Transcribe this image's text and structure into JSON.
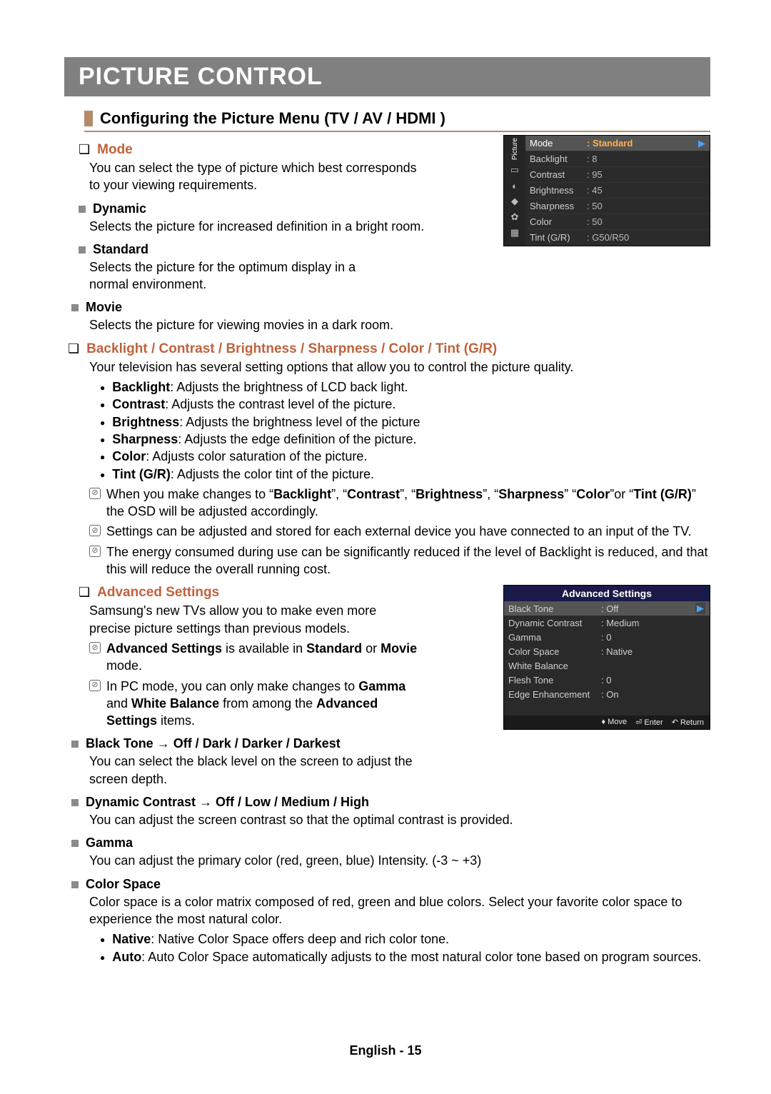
{
  "title": "PICTURE CONTROL",
  "subtitle": "Configuring the Picture Menu (TV / AV / HDMI )",
  "mode": {
    "heading": "Mode",
    "intro": "You can select the type of picture which best corresponds to your viewing requirements.",
    "dynamic_h": "Dynamic",
    "dynamic_t": "Selects the picture for increased definition in a bright room.",
    "standard_h": "Standard",
    "standard_t": "Selects the picture for the optimum display in a normal environment.",
    "movie_h": "Movie",
    "movie_t": "Selects the picture for viewing movies in a dark room."
  },
  "adj": {
    "heading": "Backlight / Contrast / Brightness / Sharpness / Color / Tint (G/R)",
    "intro": "Your television has several setting options that allow you to control the picture quality.",
    "b1_l": "Backlight",
    "b1_t": ": Adjusts the brightness of LCD back light.",
    "b2_l": "Contrast",
    "b2_t": ": Adjusts the contrast level of the picture.",
    "b3_l": "Brightness",
    "b3_t": ": Adjusts the brightness level of the picture",
    "b4_l": "Sharpness",
    "b4_t": ": Adjusts the edge definition of the picture.",
    "b5_l": "Color",
    "b5_t": ": Adjusts color saturation of the picture.",
    "b6_l": "Tint (G/R)",
    "b6_t": ": Adjusts the color tint of the picture.",
    "n1a": "When you make changes to “",
    "n1b": "Backlight",
    "n1c": "”, “",
    "n1d": "Contrast",
    "n1e": "”, “",
    "n1f": "Brightness",
    "n1g": "”, “",
    "n1h": "Sharpness",
    "n1i": "” “",
    "n1j": "Color",
    "n1k": "”or “",
    "n1l": "Tint (G/R)",
    "n1m": "” the OSD will be adjusted accordingly.",
    "n2": "Settings can be adjusted and stored for each external device you have connected to an input of the TV.",
    "n3": "The energy consumed during use can be significantly reduced if the level of Backlight is reduced, and that this will reduce the overall running cost."
  },
  "adv": {
    "heading": "Advanced Settings",
    "intro": "Samsung's new TVs allow you to make even more precise picture settings than previous models.",
    "n1_a": "Advanced Settings",
    "n1_b": " is available in ",
    "n1_c": "Standard",
    "n1_d": " or ",
    "n1_e": "Movie",
    "n1_f": " mode.",
    "n2_a": "In PC mode, you can only make changes to ",
    "n2_b": "Gamma",
    "n2_c": " and ",
    "n2_d": "White Balance",
    "n2_e": " from among the ",
    "n2_f": "Advanced Settings",
    "n2_g": " items.",
    "bt_h": "Black Tone → Off / Dark / Darker / Darkest",
    "bt_t": "You can select the black level on the screen to adjust the screen depth.",
    "dc_h": "Dynamic Contrast → Off / Low / Medium / High",
    "dc_t": "You can adjust the screen contrast so that the optimal contrast is provided.",
    "g_h": "Gamma",
    "g_t": "You can adjust the primary color (red, green, blue) Intensity. (-3 ~ +3)",
    "cs_h": "Color Space",
    "cs_t": "Color space is a color matrix composed of red, green and blue colors. Select your favorite color space to experience the most natural color.",
    "cs1_l": "Native",
    "cs1_t": ": Native Color Space offers deep and rich color tone.",
    "cs2_l": "Auto",
    "cs2_t": ": Auto Color Space automatically adjusts to the most natural color tone based on program sources."
  },
  "osd1": {
    "tab": "Picture",
    "rows": [
      {
        "label": "Mode",
        "val": ": Standard",
        "sel": true
      },
      {
        "label": "Backlight",
        "val": ": 8"
      },
      {
        "label": "Contrast",
        "val": ": 95"
      },
      {
        "label": "Brightness",
        "val": ": 45"
      },
      {
        "label": "Sharpness",
        "val": ": 50"
      },
      {
        "label": "Color",
        "val": ": 50"
      },
      {
        "label": "Tint (G/R)",
        "val": ": G50/R50"
      }
    ]
  },
  "osd2": {
    "title": "Advanced Settings",
    "rows": [
      {
        "label": "Black Tone",
        "val": ": Off",
        "sel": true
      },
      {
        "label": "Dynamic Contrast",
        "val": ": Medium"
      },
      {
        "label": "Gamma",
        "val": ": 0"
      },
      {
        "label": "Color Space",
        "val": ": Native"
      },
      {
        "label": "White Balance",
        "val": ""
      },
      {
        "label": "Flesh Tone",
        "val": ": 0"
      },
      {
        "label": "Edge Enhancement",
        "val": ": On"
      }
    ],
    "f_move": "Move",
    "f_enter": "Enter",
    "f_return": "Return"
  },
  "footer": "English - 15"
}
